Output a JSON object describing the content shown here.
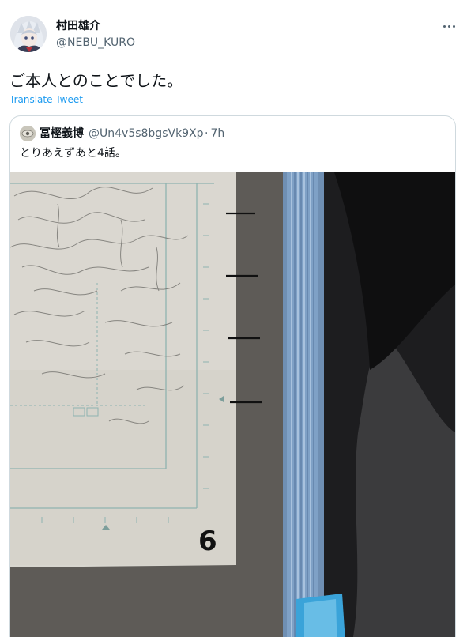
{
  "tweet": {
    "author_name": "村田雄介",
    "author_handle": "@NEBU_KURO",
    "text": "ご本人とのことでした。",
    "translate_label": "Translate Tweet",
    "more_icon": "more-horizontal-icon"
  },
  "quoted_tweet": {
    "author_name": "冨樫義博",
    "author_handle": "@Un4v5s8bgsVk9Xp",
    "time": "7h",
    "text": "とりあえずあと4話。",
    "photo": {
      "description_icon": "manga-manuscript-photo",
      "page_number": "6"
    }
  },
  "colors": {
    "primary_text": "#0f1419",
    "secondary_text": "#536471",
    "link": "#1d9bf0",
    "border": "#cfd9de",
    "ruler_blue": "#5b8fc7"
  }
}
